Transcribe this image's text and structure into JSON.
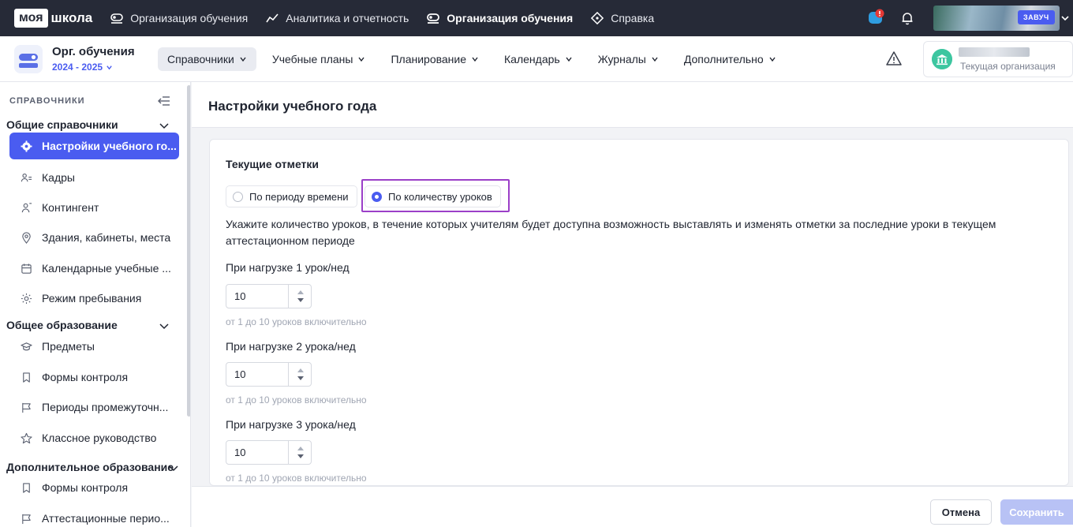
{
  "app": {
    "logo_part1": "моя",
    "logo_part2": "школа"
  },
  "topnav": [
    {
      "label": "Организация обучения",
      "icon": "organization-icon",
      "active": false
    },
    {
      "label": "Аналитика и отчетность",
      "icon": "analytics-icon",
      "active": false
    },
    {
      "label": "Организация обучения",
      "icon": "organization-icon",
      "active": true
    },
    {
      "label": "Справка",
      "icon": "help-icon",
      "active": false
    }
  ],
  "user": {
    "role": "ЗАВУЧ"
  },
  "module": {
    "title": "Орг. обучения",
    "year": "2024 - 2025"
  },
  "subnav": [
    {
      "label": "Справочники",
      "active": true
    },
    {
      "label": "Учебные планы",
      "active": false
    },
    {
      "label": "Планирование",
      "active": false
    },
    {
      "label": "Календарь",
      "active": false
    },
    {
      "label": "Журналы",
      "active": false
    },
    {
      "label": "Дополнительно",
      "active": false
    }
  ],
  "org": {
    "label": "Текущая организация"
  },
  "sidebar": {
    "header": "СПРАВОЧНИКИ",
    "groups": [
      {
        "title": "Общие справочники"
      },
      {
        "title": "Общее образование"
      },
      {
        "title": "Дополнительное образование"
      }
    ],
    "items": [
      {
        "label": "Настройки учебного го...",
        "icon": "gear-icon"
      },
      {
        "label": "Кадры",
        "icon": "staff-icon"
      },
      {
        "label": "Контингент",
        "icon": "person-icon"
      },
      {
        "label": "Здания, кабинеты, места",
        "icon": "location-pin-icon"
      },
      {
        "label": "Календарные учебные ...",
        "icon": "calendar-icon"
      },
      {
        "label": "Режим пребывания",
        "icon": "sun-icon"
      },
      {
        "label": "Предметы",
        "icon": "graduation-cap-icon"
      },
      {
        "label": "Формы контроля",
        "icon": "bookmark-icon"
      },
      {
        "label": "Периоды промежуточн...",
        "icon": "flag-icon"
      },
      {
        "label": "Классное руководство",
        "icon": "star-icon"
      },
      {
        "label": "Формы контроля",
        "icon": "bookmark-icon"
      },
      {
        "label": "Аттестационные перио...",
        "icon": "flag-icon"
      }
    ]
  },
  "page": {
    "title": "Настройки учебного года"
  },
  "marks": {
    "title": "Текущие отметки",
    "options": [
      {
        "label": "По периоду времени",
        "selected": false
      },
      {
        "label": "По количеству уроков",
        "selected": true
      }
    ],
    "description": "Укажите количество уроков, в течение которых учителям будет доступна возможность выставлять и изменять отметки за последние уроки в текущем аттестационном периоде",
    "loads": [
      {
        "label": "При нагрузке 1 урок/нед",
        "value": "10",
        "hint": "от 1 до 10 уроков включительно"
      },
      {
        "label": "При нагрузке 2 урока/нед",
        "value": "10",
        "hint": "от 1 до 10 уроков включительно"
      },
      {
        "label": "При нагрузке 3 урока/нед",
        "value": "10",
        "hint": "от 1 до 10 уроков включительно"
      }
    ]
  },
  "footer": {
    "cancel_label": "Отмена",
    "save_label": "Сохранить"
  },
  "colors": {
    "accent": "#4a5cf0",
    "topbar": "#262a37",
    "highlight": "#9b3fc8"
  }
}
